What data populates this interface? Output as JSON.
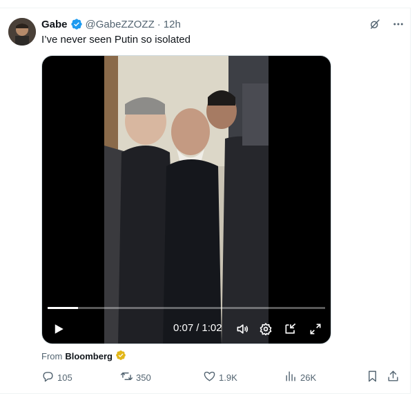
{
  "tweet": {
    "author_name": "Gabe",
    "handle": "@GabeZZOZZ",
    "separator": "·",
    "time": "12h",
    "text": "I’ve never seen Putin so isolated",
    "verified": true
  },
  "video": {
    "current_time": "0:07",
    "divider": "/",
    "duration": "1:02",
    "progress_fraction": 0.11
  },
  "source": {
    "prefix": "From",
    "name": "Bloomberg"
  },
  "actions": {
    "replies": "105",
    "reposts": "350",
    "likes": "1.9K",
    "views": "26K"
  },
  "colors": {
    "verified_blue": "#1d9bf0",
    "gold_badge": "#e2b719",
    "muted": "#536471"
  },
  "icons": [
    "verified-badge-icon",
    "grok-icon",
    "more-icon",
    "play-icon",
    "volume-icon",
    "settings-icon",
    "pip-icon",
    "fullscreen-icon",
    "gold-verified-icon",
    "reply-icon",
    "repost-icon",
    "like-icon",
    "views-icon",
    "bookmark-icon",
    "share-icon"
  ]
}
